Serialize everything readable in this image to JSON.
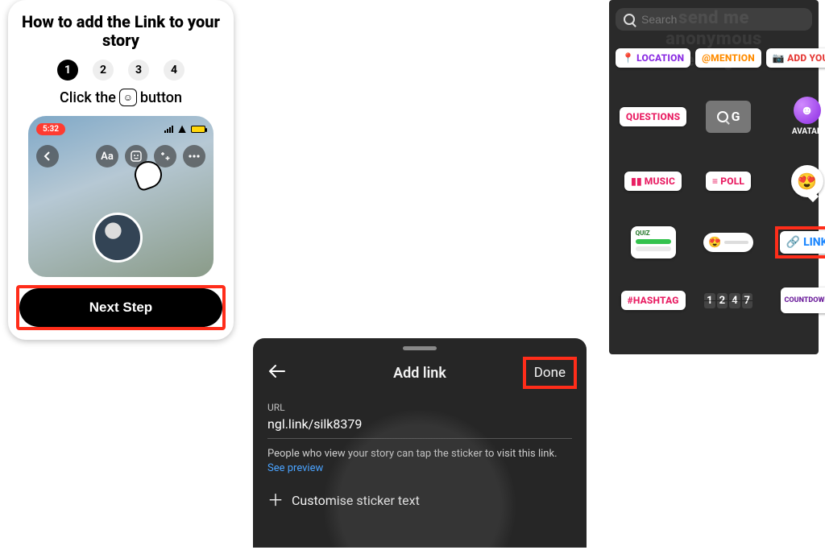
{
  "panel1": {
    "title": "How to add the Link to your story",
    "steps": [
      "1",
      "2",
      "3",
      "4"
    ],
    "active_step_index": 0,
    "instruction_pre": "Click the",
    "instruction_post": "button",
    "sticker_glyph": "☺",
    "preview": {
      "time": "5:32",
      "toolbar": {
        "text_label": "Aa"
      }
    },
    "next_label": "Next Step"
  },
  "panel2": {
    "title": "Add link",
    "done": "Done",
    "url_label": "URL",
    "url_value": "ngl.link/silk8379",
    "hint_text": "People who view your story can tap the sticker to visit this link. ",
    "hint_link": "See preview",
    "customise": "Customise sticker text"
  },
  "panel3": {
    "search_placeholder": "Search",
    "ghost": "send me\nanonymous\nmessages!",
    "stickers": {
      "location": {
        "label": "LOCATION",
        "icon": "📍"
      },
      "mention": {
        "label": "@MENTION"
      },
      "addyours": {
        "label": "ADD YOURS",
        "icon": "📷"
      },
      "questions": {
        "label": "QUESTIONS"
      },
      "gif": {
        "label": "G"
      },
      "avatar": {
        "label": "AVATAR",
        "icon": "☻"
      },
      "music": {
        "label": "MUSIC",
        "icon": "▮▮"
      },
      "poll": {
        "label": "POLL",
        "icon": "≡"
      },
      "emoji_face": "😍",
      "quiz": {
        "label": "QUIZ"
      },
      "slider_face": "😍",
      "link": {
        "label": "LINK",
        "icon": "🔗"
      },
      "hashtag": {
        "label": "#HASHTAG"
      },
      "flip_digits": [
        "1",
        "2",
        "4",
        "7"
      ],
      "countdown": {
        "label": "COUNTDOWN"
      }
    }
  }
}
